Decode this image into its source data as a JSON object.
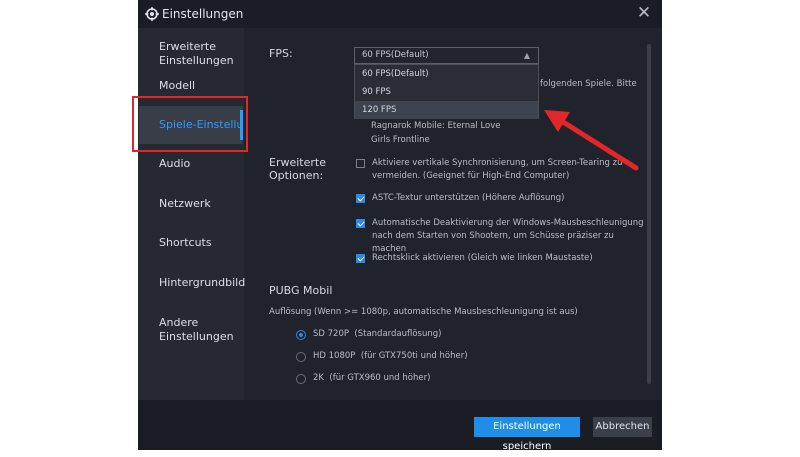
{
  "window": {
    "title": "Einstellungen",
    "close_glyph": "✕"
  },
  "sidebar": {
    "items": [
      {
        "label": "Erweiterte\nEinstellungen"
      },
      {
        "label": "Modell"
      },
      {
        "label": "Spiele-Einstellungen"
      },
      {
        "label": "Audio"
      },
      {
        "label": "Netzwerk"
      },
      {
        "label": "Shortcuts"
      },
      {
        "label": "Hintergrundbild"
      },
      {
        "label": "Andere\nEinstellungen"
      }
    ],
    "active_index": 2
  },
  "fps": {
    "label": "FPS:",
    "selected": "60 FPS(Default)",
    "options": [
      "60 FPS(Default)",
      "90 FPS",
      "120 FPS"
    ],
    "hover_index": 2,
    "hint_partial": "folgenden Spiele. Bitte",
    "games": [
      "Ragnarok Mobile: Eternal Love",
      "Girls Frontline"
    ]
  },
  "advanced": {
    "label": "Erweiterte\nOptionen:",
    "options": [
      {
        "text": "Aktiviere vertikale Synchronisierung, um Screen-Tearing zu vermeiden.  (Geeignet für High-End Computer)",
        "checked": false
      },
      {
        "text": "ASTC-Textur unterstützen  (Höhere Auflösung)",
        "checked": true
      },
      {
        "text": "Automatische Deaktivierung der Windows-Mausbeschleunigung nach dem Starten von Shootern, um Schüsse präziser zu machen",
        "checked": true
      },
      {
        "text": "Rechtsklick aktivieren (Gleich wie linken Maustaste)",
        "checked": true
      }
    ]
  },
  "pubg": {
    "title": "PUBG Mobil",
    "resolution_label": "Auflösung (Wenn >= 1080p, automatische Mausbeschleunigung ist aus)",
    "resolutions": [
      {
        "name": "SD 720P",
        "note": "(Standardauflösung)",
        "selected": true
      },
      {
        "name": "HD 1080P",
        "note": "(für GTX750ti und höher)",
        "selected": false
      },
      {
        "name": "2K",
        "note": "(für GTX960 und höher)",
        "selected": false
      }
    ]
  },
  "footer": {
    "save_label": "Einstellungen speichern",
    "cancel_label": "Abbrechen"
  },
  "colors": {
    "accent": "#2f9bff",
    "annotation": "#e2272b",
    "primary_button": "#1f8ee8"
  }
}
